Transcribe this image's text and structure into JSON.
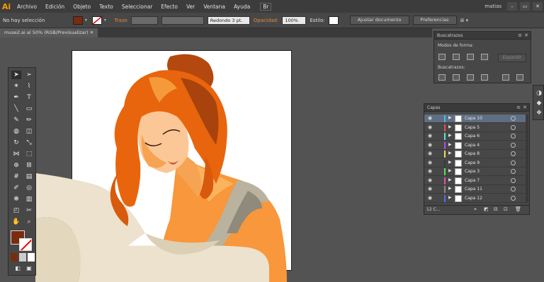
{
  "app": {
    "logo": "Ai",
    "user": "matias"
  },
  "menu": [
    "Archivo",
    "Edición",
    "Objeto",
    "Texto",
    "Seleccionar",
    "Efecto",
    "Ver",
    "Ventana",
    "Ayuda"
  ],
  "control": {
    "selection": "No hay selección",
    "fill_color": "#7a2c10",
    "stroke_label": "Trazo",
    "brush": "Redondo 3 pt.",
    "opacity_label": "Opacidad:",
    "opacity": "100%",
    "style_label": "Estilo:",
    "ajustar": "Ajustar documento",
    "prefs": "Preferencias"
  },
  "document": {
    "tab": "muse2.ai al 50% (RGB/Previsualizar)"
  },
  "pathfinder": {
    "title": "Buscatrazos",
    "shape_modes": "Modos de forma:",
    "expand": "Expandir",
    "pathfinders": "Buscatrazos:"
  },
  "layers": {
    "title": "Capas",
    "count": "12 C...",
    "rows": [
      {
        "name": "Capa 10",
        "color": "#4fb6e8",
        "selected": true
      },
      {
        "name": "Capa 5",
        "color": "#e84f4f",
        "selected": false
      },
      {
        "name": "Capa 6",
        "color": "#4fe8e0",
        "selected": false
      },
      {
        "name": "Capa 4",
        "color": "#b04fe8",
        "selected": false
      },
      {
        "name": "Capa 8",
        "color": "#e0e04f",
        "selected": false
      },
      {
        "name": "Capa 9",
        "color": "#3a3a3a",
        "selected": false
      },
      {
        "name": "Capa 3",
        "color": "#4fe84f",
        "selected": false
      },
      {
        "name": "Capa 7",
        "color": "#e04fb8",
        "selected": false
      },
      {
        "name": "Capa 11",
        "color": "#8a8a8a",
        "selected": false
      },
      {
        "name": "Capa 12",
        "color": "#4f6fe8",
        "selected": false
      }
    ]
  },
  "colors": {
    "accent": "#ff9a00",
    "stroke_label": "#e08a3c"
  }
}
